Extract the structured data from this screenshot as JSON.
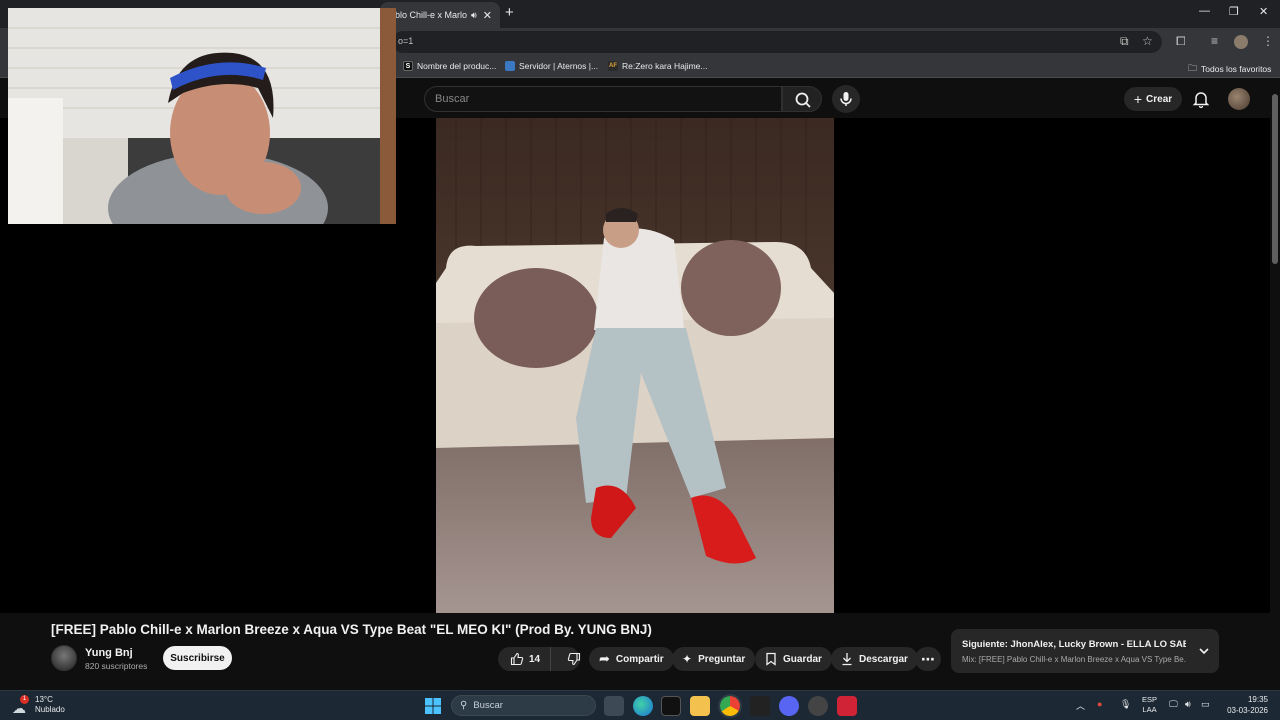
{
  "browser": {
    "tab_title": "ablo Chill-e x Marlo",
    "url_fragment": "o=1",
    "bookmarks": [
      {
        "label": "Nombre del produc...",
        "icon": "S"
      },
      {
        "label": "Servidor | Aternos |...",
        "icon": ""
      },
      {
        "label": "Re:Zero kara Hajime...",
        "icon": "AF"
      }
    ],
    "all_bookmarks": "Todos los favoritos"
  },
  "youtube": {
    "search_placeholder": "Buscar",
    "create_label": "Crear"
  },
  "video": {
    "title": "[FREE] Pablo Chill-e x Marlon Breeze x Aqua VS Type Beat \"EL MEO KI\" (Prod By. YUNG BNJ)",
    "channel": "Yung Bnj",
    "subscribers": "820 suscriptores",
    "subscribe_label": "Suscribirse",
    "likes": "14",
    "share_label": "Compartir",
    "ask_label": "Preguntar",
    "save_label": "Guardar",
    "download_label": "Descargar"
  },
  "up_next": {
    "title": "Siguiente: JhonAlex, Lucky Brown - ELLA LO SABE (...",
    "subtitle": "Mix: [FREE] Pablo Chill-e x Marlon Breeze x Aqua VS Type Be..."
  },
  "taskbar": {
    "weather_badge": "1",
    "temperature": "13°C",
    "weather_desc": "Nublado",
    "search_label": "Buscar",
    "lang_top": "ESP",
    "lang_bottom": "LAA",
    "time": "19:35",
    "date": "03-03-2026"
  },
  "colors": {
    "yt_bg": "#0f0f0f",
    "chrome_bg": "#35363a",
    "taskbar_bg": "#1c2833",
    "accent_red": "#ff0000"
  }
}
